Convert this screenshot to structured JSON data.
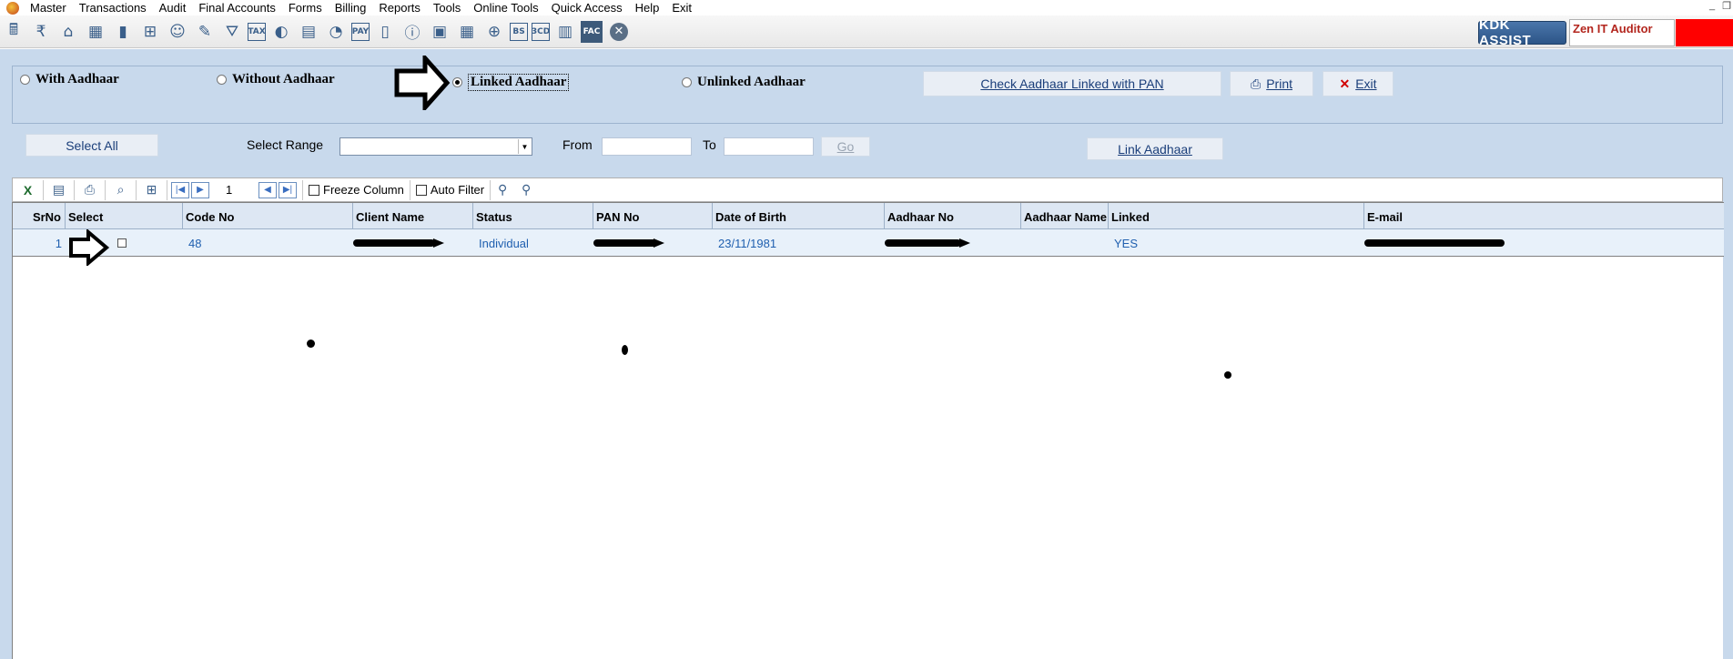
{
  "menu": {
    "items": [
      "Master",
      "Transactions",
      "Audit",
      "Final Accounts",
      "Forms",
      "Billing",
      "Reports",
      "Tools",
      "Online Tools",
      "Quick Access",
      "Help",
      "Exit"
    ]
  },
  "toolbar": {
    "kdk_label": "KDK ASSIST",
    "product_label": "Zen IT Auditor",
    "icon_tax": "TAX",
    "icon_pay": "PAY",
    "icon_bs": "BS",
    "icon_3cd": "3CD",
    "icon_fac": "FAC"
  },
  "filters": {
    "with_aadhaar": "With Aadhaar",
    "without_aadhaar": "Without Aadhaar",
    "linked_aadhaar": "Linked Aadhaar",
    "unlinked_aadhaar": "Unlinked Aadhaar",
    "selected": "Linked Aadhaar"
  },
  "actions": {
    "check_pan": "Check Aadhaar Linked with PAN",
    "print": "Print",
    "exit": "Exit",
    "select_all": "Select All",
    "select_range_label": "Select Range",
    "from_label": "From",
    "to_label": "To",
    "go": "Go",
    "link_aadhaar": "Link Aadhaar"
  },
  "grid_toolbar": {
    "page": "1",
    "freeze_column": "Freeze Column",
    "auto_filter": "Auto Filter"
  },
  "grid": {
    "columns": [
      "SrNo",
      "Select",
      "Code No",
      "Client Name",
      "Status",
      "PAN No",
      "Date of Birth",
      "Aadhaar No",
      "Aadhaar Name",
      "Linked",
      "E-mail"
    ],
    "rows": [
      {
        "srno": "1",
        "code_no": "48",
        "status": "Individual",
        "dob": "23/11/1981",
        "linked": "YES"
      }
    ]
  },
  "colors": {
    "panel_bg": "#c8d9ec",
    "link_text": "#2060b0",
    "kdk_blue": "#2c5587",
    "alert_red": "#ff0000"
  }
}
